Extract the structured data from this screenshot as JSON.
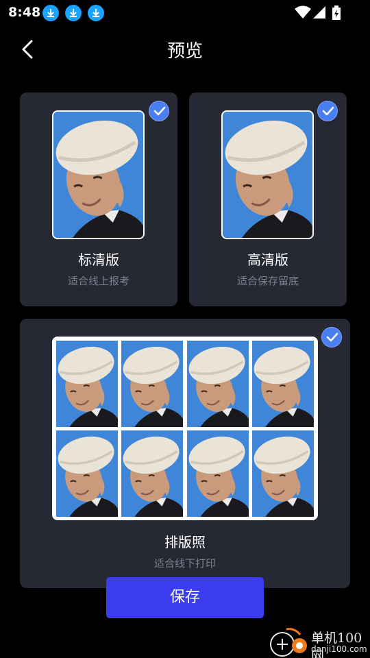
{
  "status_bar": {
    "time": "8:48"
  },
  "header": {
    "title": "预览"
  },
  "options": [
    {
      "title": "标清版",
      "subtitle": "适合线上报考",
      "checked": true
    },
    {
      "title": "高清版",
      "subtitle": "适合保存留底",
      "checked": true
    },
    {
      "title": "排版照",
      "subtitle": "适合线下打印",
      "checked": true
    }
  ],
  "save_button": {
    "label": "保存"
  },
  "watermark": {
    "name": "单机100网",
    "url": "danji100.com"
  },
  "colors": {
    "accent": "#3d3df0",
    "check": "#4a7ff0",
    "photo_bg": "#3f86d9",
    "card": "#262834"
  }
}
